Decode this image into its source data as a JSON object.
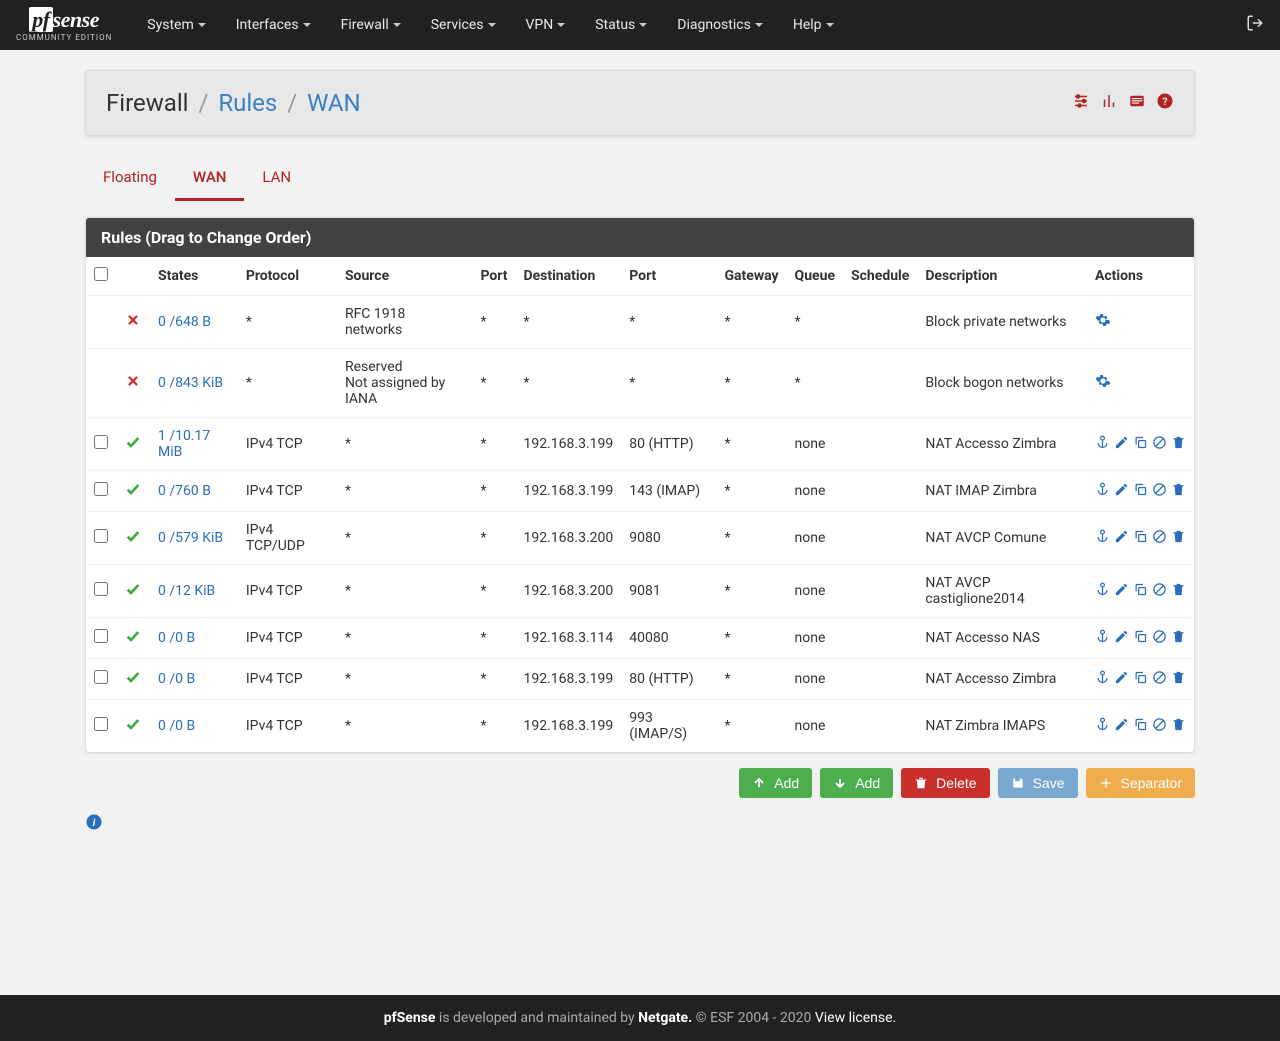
{
  "brand": {
    "name": "pfsense",
    "edition": "COMMUNITY EDITION"
  },
  "nav": [
    "System",
    "Interfaces",
    "Firewall",
    "Services",
    "VPN",
    "Status",
    "Diagnostics",
    "Help"
  ],
  "breadcrumb": {
    "part1": "Firewall",
    "part2": "Rules",
    "part3": "WAN"
  },
  "tabs": [
    {
      "label": "Floating",
      "active": false
    },
    {
      "label": "WAN",
      "active": true
    },
    {
      "label": "LAN",
      "active": false
    }
  ],
  "panel_title": "Rules (Drag to Change Order)",
  "columns": [
    "",
    "",
    "States",
    "Protocol",
    "Source",
    "Port",
    "Destination",
    "Port",
    "Gateway",
    "Queue",
    "Schedule",
    "Description",
    "Actions"
  ],
  "rules": [
    {
      "cb": false,
      "status": "block",
      "states": "0 /648 B",
      "protocol": "*",
      "source": "RFC 1918 networks",
      "sport": "*",
      "dest": "*",
      "dport": "*",
      "gateway": "*",
      "queue": "*",
      "schedule": "",
      "description": "Block private networks",
      "actions": "gear"
    },
    {
      "cb": false,
      "status": "block",
      "states": "0 /843 KiB",
      "protocol": "*",
      "source": "Reserved\nNot assigned by IANA",
      "sport": "*",
      "dest": "*",
      "dport": "*",
      "gateway": "*",
      "queue": "*",
      "schedule": "",
      "description": "Block bogon networks",
      "actions": "gear"
    },
    {
      "cb": true,
      "status": "pass",
      "states": "1 /10.17 MiB",
      "protocol": "IPv4 TCP",
      "source": "*",
      "sport": "*",
      "dest": "192.168.3.199",
      "dport": "80 (HTTP)",
      "gateway": "*",
      "queue": "none",
      "schedule": "",
      "description": "NAT Accesso Zimbra",
      "actions": "full"
    },
    {
      "cb": true,
      "status": "pass",
      "states": "0 /760 B",
      "protocol": "IPv4 TCP",
      "source": "*",
      "sport": "*",
      "dest": "192.168.3.199",
      "dport": "143 (IMAP)",
      "gateway": "*",
      "queue": "none",
      "schedule": "",
      "description": "NAT IMAP Zimbra",
      "actions": "full"
    },
    {
      "cb": true,
      "status": "pass",
      "states": "0 /579 KiB",
      "protocol": "IPv4 TCP/UDP",
      "source": "*",
      "sport": "*",
      "dest": "192.168.3.200",
      "dport": "9080",
      "gateway": "*",
      "queue": "none",
      "schedule": "",
      "description": "NAT AVCP Comune",
      "actions": "full"
    },
    {
      "cb": true,
      "status": "pass",
      "states": "0 /12 KiB",
      "protocol": "IPv4 TCP",
      "source": "*",
      "sport": "*",
      "dest": "192.168.3.200",
      "dport": "9081",
      "gateway": "*",
      "queue": "none",
      "schedule": "",
      "description": "NAT AVCP castiglione2014",
      "actions": "full"
    },
    {
      "cb": true,
      "status": "pass",
      "states": "0 /0 B",
      "protocol": "IPv4 TCP",
      "source": "*",
      "sport": "*",
      "dest": "192.168.3.114",
      "dport": "40080",
      "gateway": "*",
      "queue": "none",
      "schedule": "",
      "description": "NAT Accesso NAS",
      "actions": "full"
    },
    {
      "cb": true,
      "status": "pass",
      "states": "0 /0 B",
      "protocol": "IPv4 TCP",
      "source": "*",
      "sport": "*",
      "dest": "192.168.3.199",
      "dport": "80 (HTTP)",
      "gateway": "*",
      "queue": "none",
      "schedule": "",
      "description": "NAT Accesso Zimbra",
      "actions": "full"
    },
    {
      "cb": true,
      "status": "pass",
      "states": "0 /0 B",
      "protocol": "IPv4 TCP",
      "source": "*",
      "sport": "*",
      "dest": "192.168.3.199",
      "dport": "993 (IMAP/S)",
      "gateway": "*",
      "queue": "none",
      "schedule": "",
      "description": "NAT Zimbra IMAPS",
      "actions": "full"
    }
  ],
  "buttons": {
    "add_up": "Add",
    "add_down": "Add",
    "delete": "Delete",
    "save": "Save",
    "separator": "Separator"
  },
  "footer": {
    "product": "pfSense",
    "text1": " is developed and maintained by ",
    "company": "Netgate.",
    "text2": " © ESF 2004 - 2020 ",
    "license": "View license."
  }
}
